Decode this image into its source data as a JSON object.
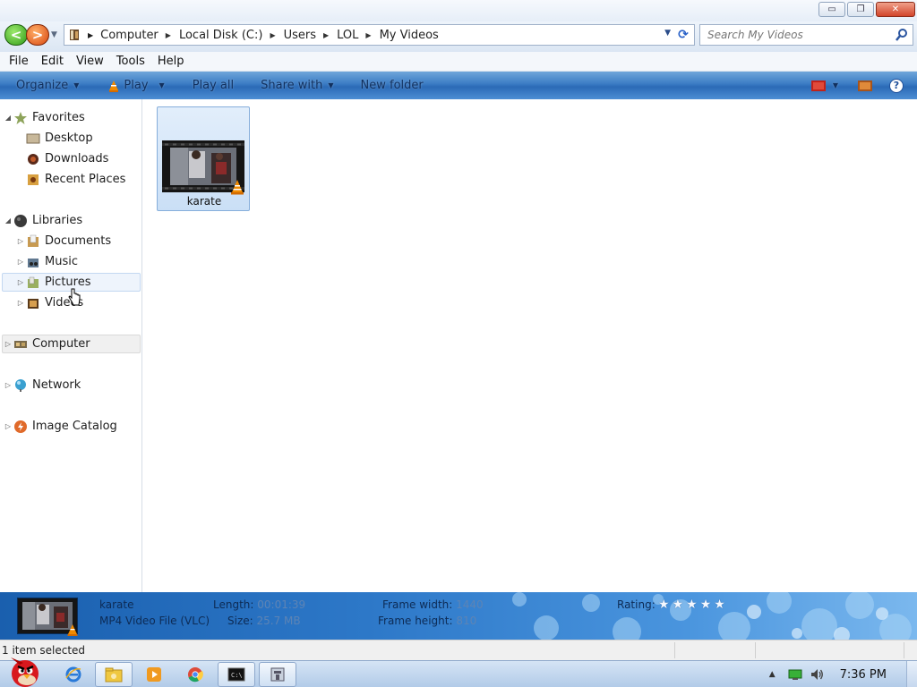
{
  "window": {
    "minimize_label": "▭",
    "maximize_label": "❐",
    "close_label": "✕"
  },
  "address": {
    "crumbs": [
      "Computer",
      "Local Disk (C:)",
      "Users",
      "LOL",
      "My Videos"
    ],
    "search_placeholder": "Search My Videos"
  },
  "menu": {
    "items": [
      "File",
      "Edit",
      "View",
      "Tools",
      "Help"
    ]
  },
  "toolbar": {
    "organize": "Organize",
    "play": "Play",
    "play_all": "Play all",
    "share_with": "Share with",
    "new_folder": "New folder",
    "help": "?"
  },
  "sidebar": {
    "favorites": {
      "label": "Favorites",
      "items": [
        "Desktop",
        "Downloads",
        "Recent Places"
      ]
    },
    "libraries": {
      "label": "Libraries",
      "items": [
        "Documents",
        "Music",
        "Pictures",
        "Videos"
      ]
    },
    "computer": "Computer",
    "network": "Network",
    "image_catalog": "Image Catalog"
  },
  "files": [
    {
      "name": "karate",
      "icon": "video-thumbnail-icon"
    }
  ],
  "details": {
    "name": "karate",
    "type": "MP4 Video File (VLC)",
    "length_label": "Length:",
    "length_value": "00:01:39",
    "size_label": "Size:",
    "size_value": "25.7 MB",
    "frame_width_label": "Frame width:",
    "frame_width_value": "1440",
    "frame_height_label": "Frame height:",
    "frame_height_value": "810",
    "rating_label": "Rating:",
    "rating_stars": 0,
    "rating_max": 5
  },
  "status": {
    "text": "1 item selected"
  },
  "taskbar": {
    "clock": "7:36 PM",
    "apps": [
      "angry-birds-start-icon",
      "internet-explorer-icon",
      "windows-explorer-icon",
      "media-player-icon",
      "chrome-icon",
      "command-prompt-icon",
      "tool-icon"
    ]
  },
  "colors": {
    "command_bar": "#3a7bc4",
    "selection": "#cadff6",
    "details_pane": "#2d78c8"
  }
}
